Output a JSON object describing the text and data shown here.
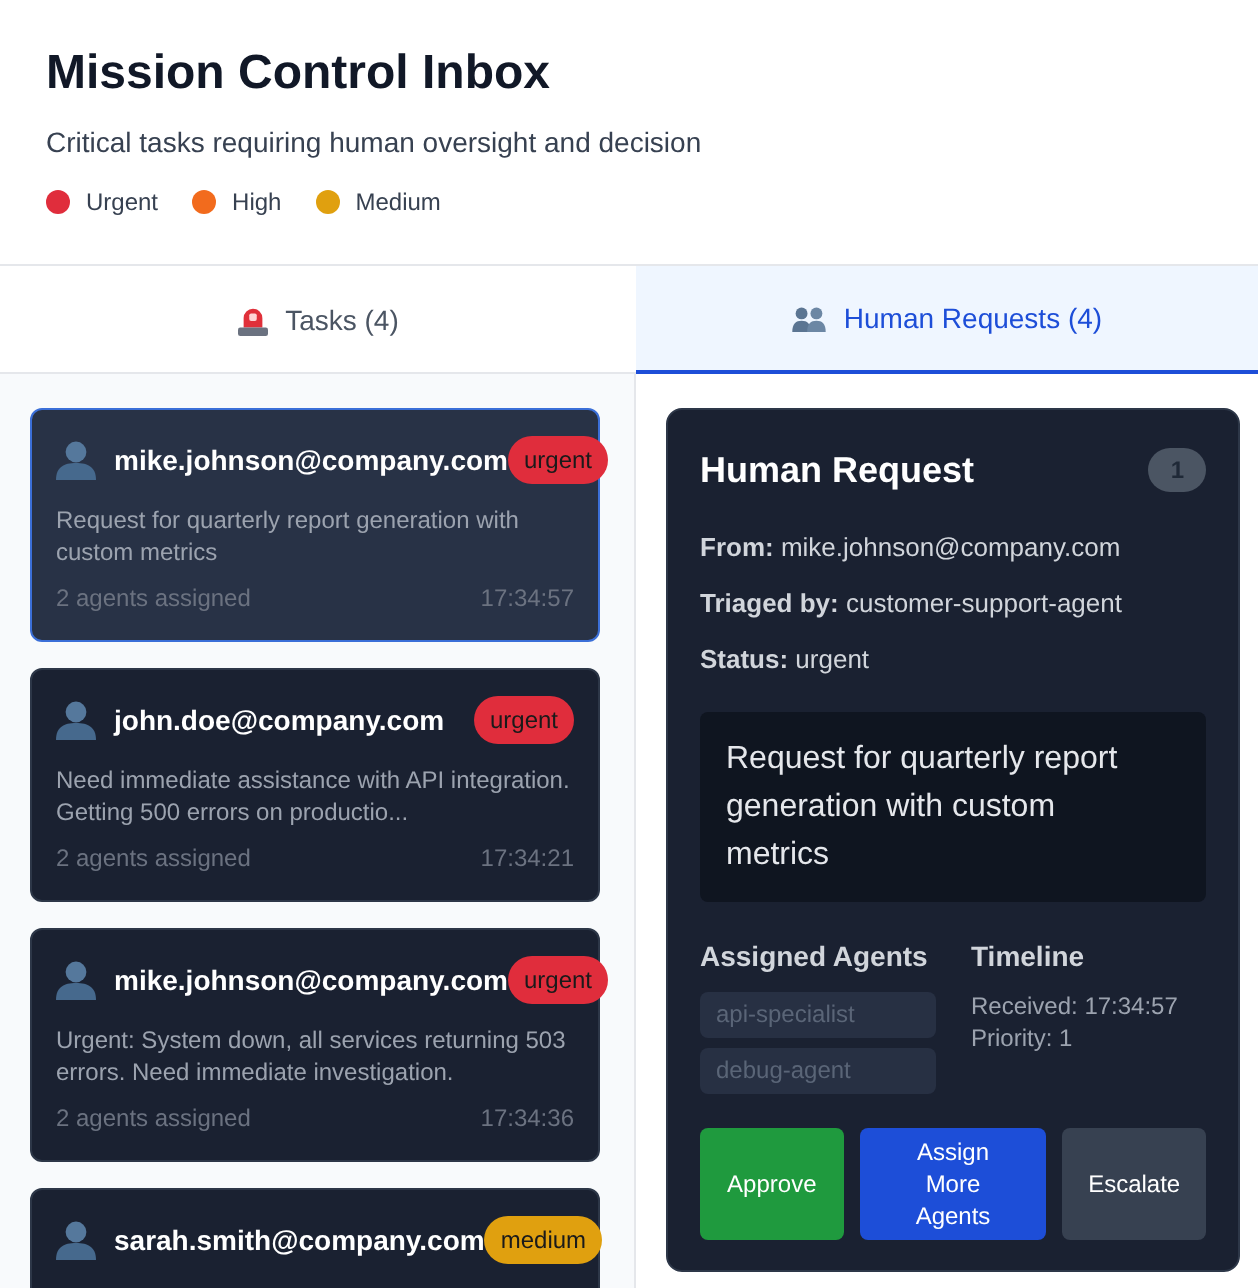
{
  "header": {
    "title": "Mission Control Inbox",
    "subtitle": "Critical tasks requiring human oversight and decision",
    "legend": [
      {
        "label": "Urgent",
        "color": "#e02d3c"
      },
      {
        "label": "High",
        "color": "#f26b1d"
      },
      {
        "label": "Medium",
        "color": "#e0a00f"
      }
    ]
  },
  "tabs": [
    {
      "label": "Tasks (4)",
      "kind": "tasks",
      "selected": false
    },
    {
      "label": "Human Requests (4)",
      "kind": "requests",
      "selected": true
    }
  ],
  "tasks": [
    {
      "sender": "mike.johnson@company.com",
      "badge": {
        "label": "urgent",
        "color": "#e02d3c"
      },
      "selected": true,
      "summary": "Request for quarterly report generation with custom metrics",
      "agents": "2 agents assigned",
      "time": "17:34:57"
    },
    {
      "sender": "john.doe@company.com",
      "badge": {
        "label": "urgent",
        "color": "#e02d3c"
      },
      "selected": false,
      "summary": "Need immediate assistance with API integration. Getting 500 errors on productio...",
      "agents": "2 agents assigned",
      "time": "17:34:21"
    },
    {
      "sender": "mike.johnson@company.com",
      "badge": {
        "label": "urgent",
        "color": "#e02d3c"
      },
      "selected": false,
      "summary": "Urgent: System down, all services returning 503 errors. Need immediate investigation.",
      "agents": "2 agents assigned",
      "time": "17:34:36"
    },
    {
      "sender": "sarah.smith@company.com",
      "badge": {
        "label": "medium",
        "color": "#e0a00f"
      },
      "selected": false
    }
  ],
  "detail": {
    "title": "Human Request",
    "count": "1",
    "fields": [
      "**From:** mike.johnson@company.com",
      "**Triaged by:** customer-support-agent",
      "**Status:** urgent"
    ],
    "message": "Request for quarterly report generation with custom metrics",
    "agents_heading": "Assigned Agents",
    "agents": [
      "api-specialist",
      "debug-agent"
    ],
    "timeline_heading": "Timeline",
    "timeline": [
      "Received: 17:34:57",
      "Priority: 1"
    ],
    "buttons": [
      {
        "label": "Approve",
        "kind": "approve"
      },
      {
        "label": "Assign More Agents",
        "kind": "assign"
      },
      {
        "label": "Escalate",
        "kind": "escalate"
      }
    ]
  }
}
